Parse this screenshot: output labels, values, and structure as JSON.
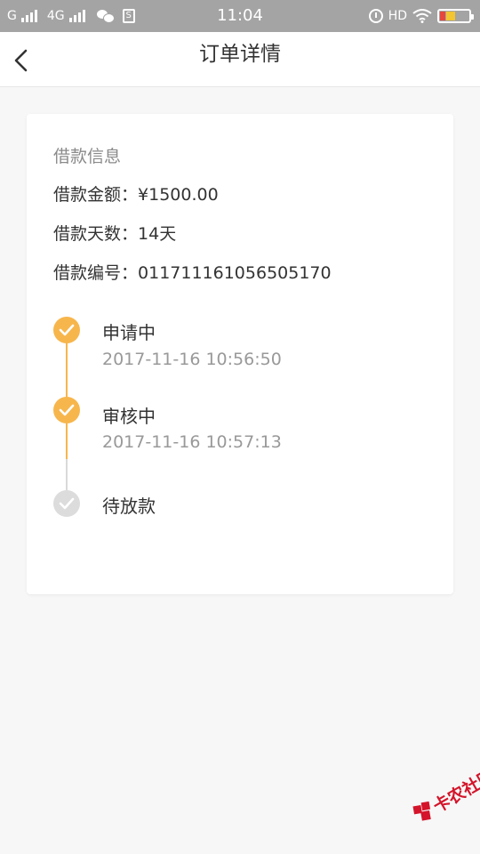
{
  "status_bar": {
    "carrier1": "G",
    "carrier2": "4G",
    "app_icon_s": "S",
    "time": "11:04",
    "hd_label": "HD",
    "icons": [
      "signal-icon",
      "wechat-icon",
      "alarm-icon",
      "wifi-icon",
      "battery-icon"
    ]
  },
  "header": {
    "title": "订单详情",
    "back_icon": "chevron-left-icon"
  },
  "loan_info": {
    "section_title": "借款信息",
    "amount_label": "借款金额：",
    "amount_value": "¥1500.00",
    "days_label": "借款天数：",
    "days_value": "14天",
    "number_label": "借款编号：",
    "number_value": "011711161056505170"
  },
  "timeline": {
    "steps": [
      {
        "label": "申请中",
        "time": "2017-11-16 10:56:50",
        "status": "done"
      },
      {
        "label": "审核中",
        "time": "2017-11-16 10:57:13",
        "status": "done"
      },
      {
        "label": "待放款",
        "time": "",
        "status": "pending"
      }
    ]
  },
  "watermark": {
    "text": "卡农社区"
  },
  "colors": {
    "accent": "#f7b64c",
    "pending": "#dcdcdc",
    "status_bar": "#a4a4a4",
    "watermark": "#d4142a"
  }
}
